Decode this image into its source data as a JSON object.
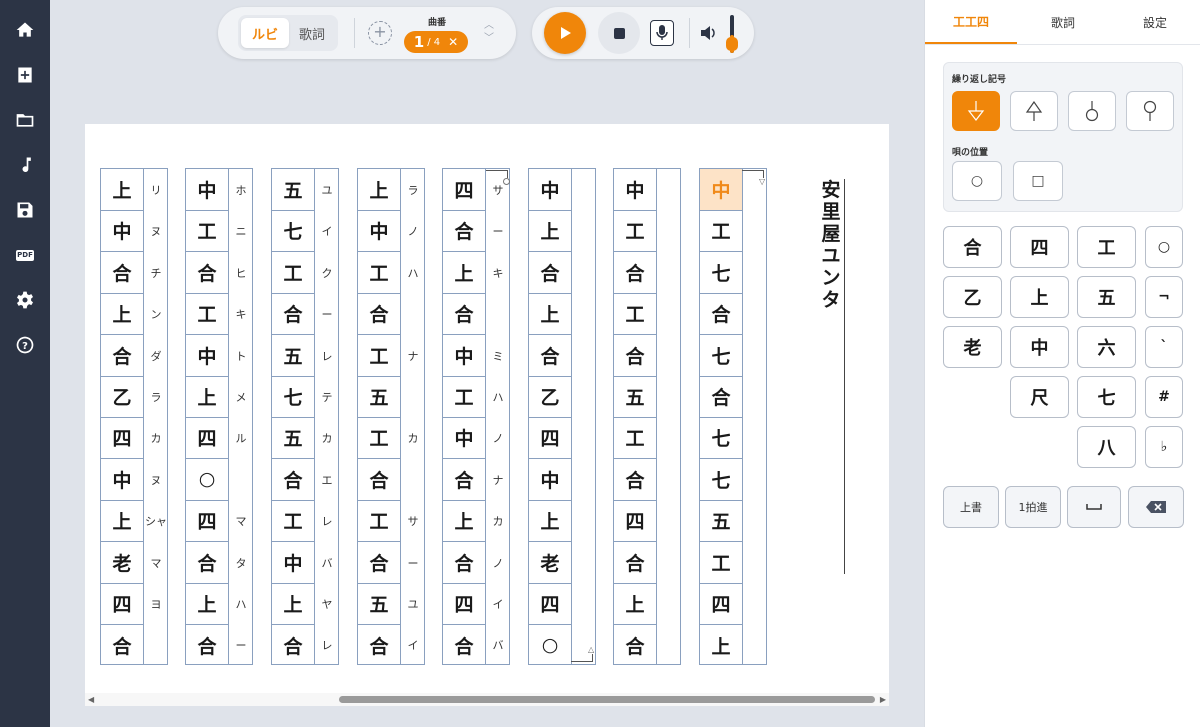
{
  "sidebar": {
    "items": [
      {
        "icon": "home-icon"
      },
      {
        "icon": "add-file-icon"
      },
      {
        "icon": "folder-icon"
      },
      {
        "icon": "music-note-icon"
      },
      {
        "icon": "save-icon"
      },
      {
        "icon": "pdf-icon",
        "badge": "PDF"
      },
      {
        "icon": "gear-icon"
      },
      {
        "icon": "help-icon"
      }
    ]
  },
  "toolbar": {
    "ruby_label": "ルビ",
    "lyrics_label": "歌詞",
    "add_label": "+",
    "kyoku_label": "曲番",
    "kyoku_current": "1",
    "kyoku_total": "/ 4",
    "kyoku_close": "✕"
  },
  "score": {
    "title": "安里屋ユンタ",
    "columns": [
      {
        "notes": [
          "上",
          "中",
          "合",
          "上",
          "合",
          "乙",
          "四",
          "中",
          "上",
          "老",
          "四",
          "合"
        ],
        "ruby": [
          "リ",
          "ヌ",
          "チ",
          "ン",
          "ダ",
          "ラ",
          "カ",
          "ヌ",
          "シャ",
          "マ",
          "ヨ",
          ""
        ]
      },
      {
        "notes": [
          "中",
          "工",
          "合",
          "工",
          "中",
          "上",
          "四",
          "○",
          "四",
          "合",
          "上",
          "合"
        ],
        "ruby": [
          "ホ",
          "ニ",
          "ヒ",
          "キ",
          "ト",
          "メ",
          "ル",
          "",
          "マ",
          "タ",
          "ハ",
          "ー"
        ]
      },
      {
        "notes": [
          "五",
          "七",
          "工",
          "合",
          "五",
          "七",
          "五",
          "合",
          "工",
          "中",
          "上",
          "合"
        ],
        "ruby": [
          "ユ",
          "イ",
          "ク",
          "ー",
          "レ",
          "テ",
          "カ",
          "エ",
          "レ",
          "バ",
          "ヤ",
          "レ"
        ]
      },
      {
        "notes": [
          "上",
          "中",
          "工",
          "合",
          "工",
          "五",
          "工",
          "合",
          "工",
          "合",
          "五",
          "合"
        ],
        "ruby": [
          "ラ",
          "ノ",
          "ハ",
          "",
          "ナ",
          "",
          "カ",
          "",
          "サ",
          "ー",
          "ユ",
          "イ"
        ]
      },
      {
        "notes": [
          "四",
          "合",
          "上",
          "合",
          "中",
          "工",
          "中",
          "合",
          "上",
          "合",
          "四",
          "合"
        ],
        "ruby": [
          "サ",
          "ー",
          "キ",
          "",
          "ミ",
          "ハ",
          "ノ",
          "ナ",
          "カ",
          "ノ",
          "イ",
          "バ"
        ]
      },
      {
        "notes": [
          "中",
          "上",
          "合",
          "上",
          "合",
          "乙",
          "四",
          "中",
          "上",
          "老",
          "四",
          "○"
        ],
        "ruby": [
          "",
          "",
          "",
          "",
          "",
          "",
          "",
          "",
          "",
          "",
          "",
          ""
        ]
      },
      {
        "notes": [
          "中",
          "工",
          "合",
          "工",
          "合",
          "五",
          "工",
          "合",
          "四",
          "合",
          "上",
          "合"
        ],
        "ruby": [
          "",
          "",
          "",
          "",
          "",
          "",
          "",
          "",
          "",
          "",
          "",
          ""
        ]
      },
      {
        "notes": [
          "中",
          "工",
          "七",
          "合",
          "七",
          "合",
          "七",
          "七",
          "五",
          "工",
          "四",
          "上"
        ],
        "ruby": [
          "",
          "",
          "",
          "",
          "",
          "",
          "",
          "",
          "",
          "",
          "",
          ""
        ]
      }
    ]
  },
  "panel": {
    "tabs": [
      "工工四",
      "歌詞",
      "設定"
    ],
    "repeat_label": "繰り返し記号",
    "repeat_symbols": [
      "⏚",
      "⍋",
      "○",
      "⚲"
    ],
    "position_label": "唄の位置",
    "position_symbols": [
      "○",
      "□"
    ],
    "keys": [
      [
        "合",
        "四",
        "工",
        "○"
      ],
      [
        "乙",
        "上",
        "五",
        "¬"
      ],
      [
        "老",
        "中",
        "六",
        "`"
      ],
      [
        "",
        "尺",
        "七",
        "#"
      ],
      [
        "",
        "",
        "八",
        "♭"
      ]
    ],
    "actions": {
      "overwrite": "上書",
      "advance": "1拍進",
      "space": "⎵",
      "backspace": "⌫"
    }
  },
  "colors": {
    "accent": "#f0860a",
    "sidebar": "#2c3445",
    "grid": "#8aa0bf",
    "highlight": "#fde3c7"
  }
}
